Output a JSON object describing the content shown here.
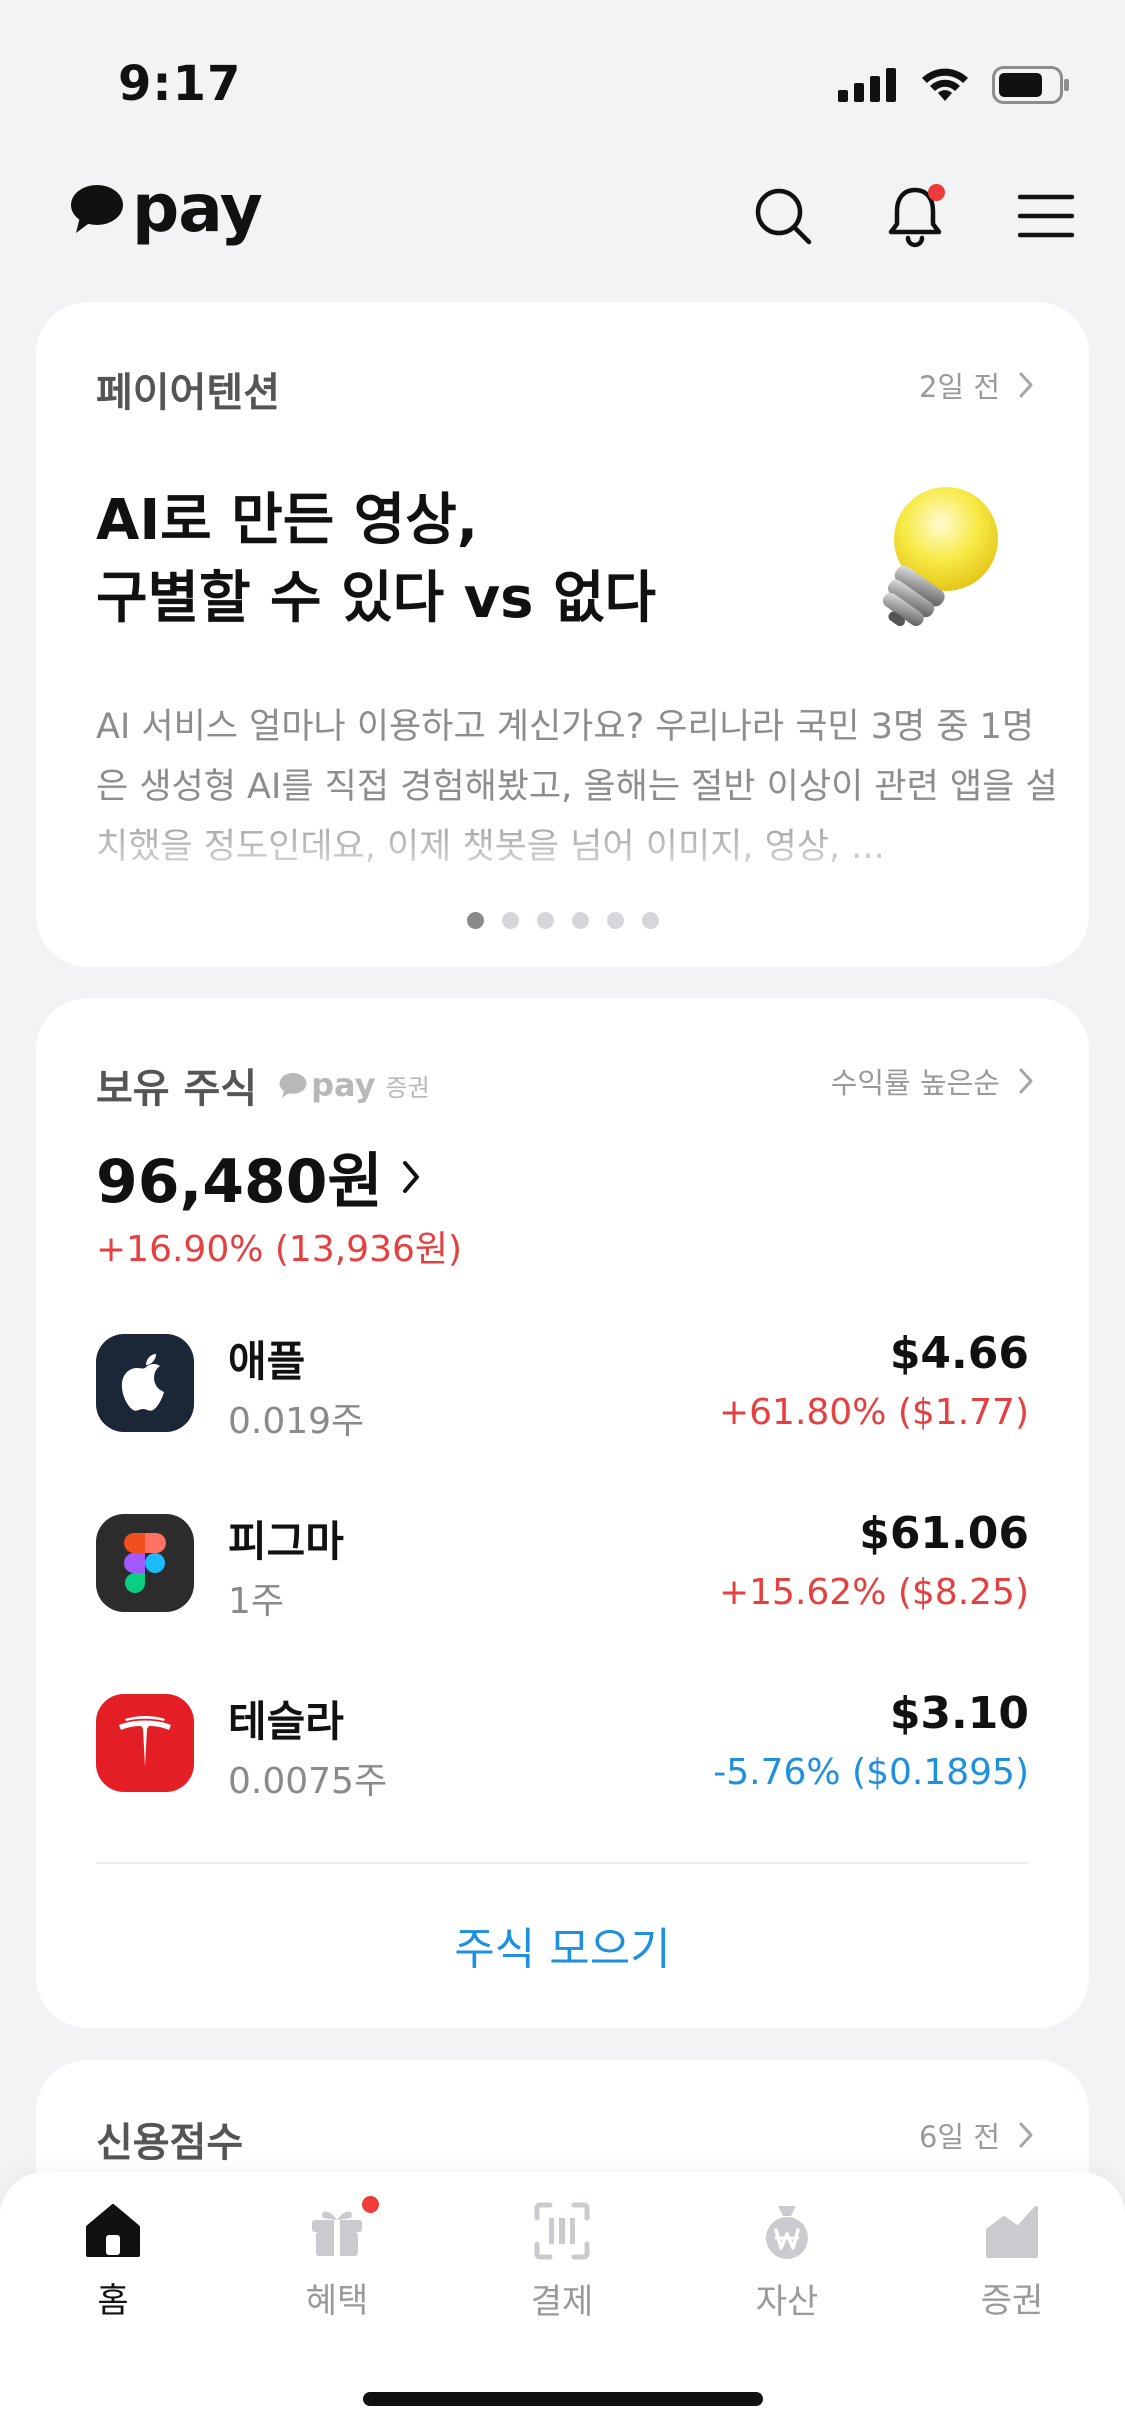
{
  "status": {
    "time": "9:17"
  },
  "header": {
    "logo_text": "pay"
  },
  "attention": {
    "title": "페이어텐션",
    "meta": "2일 전",
    "headline_line1": "AI로 만든 영상,",
    "headline_line2": "구별할 수 있다 vs 없다",
    "body": "AI 서비스 얼마나 이용하고 계신가요? 우리나라 국민 3명 중 1명은 생성형 AI를 직접 경험해봤고, 올해는 절반 이상이 관련 앱을 설치했을 정도인데요, 이제 챗봇을 넘어 이미지, 영상, ...",
    "dots_total": 6,
    "dots_active": 1
  },
  "stocks": {
    "title": "보유 주식",
    "provider_text": "pay",
    "provider_sub": "증권",
    "sort_label": "수익률 높은순",
    "total": "96,480원",
    "total_change": "+16.90% (13,936원)",
    "items": [
      {
        "name": "애플",
        "qty": "0.019주",
        "price": "$4.66",
        "change": "+61.80% ($1.77)",
        "direction": "up",
        "icon": "apple-icon"
      },
      {
        "name": "피그마",
        "qty": "1주",
        "price": "$61.06",
        "change": "+15.62% ($8.25)",
        "direction": "up",
        "icon": "figma-icon"
      },
      {
        "name": "테슬라",
        "qty": "0.0075주",
        "price": "$3.10",
        "change": "-5.76% ($0.1895)",
        "direction": "down",
        "icon": "tesla-icon"
      }
    ],
    "collect_label": "주식 모으기"
  },
  "credit": {
    "title": "신용점수",
    "meta": "6일 전"
  },
  "tabs": [
    {
      "label": "홈",
      "icon": "home-icon",
      "active": true
    },
    {
      "label": "혜택",
      "icon": "gift-icon",
      "active": false,
      "badge": true
    },
    {
      "label": "결제",
      "icon": "barcode-scan-icon",
      "active": false
    },
    {
      "label": "자산",
      "icon": "money-bag-icon",
      "active": false
    },
    {
      "label": "증권",
      "icon": "chart-icon",
      "active": false
    }
  ],
  "colors": {
    "up": "#e5403f",
    "down": "#1f8fe0",
    "accent": "#1f8fe0",
    "badge": "#f03b3b"
  }
}
